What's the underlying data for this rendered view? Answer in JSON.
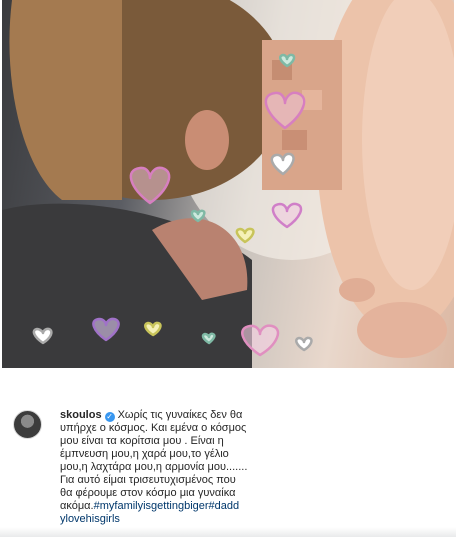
{
  "post": {
    "username": "skoulos",
    "caption_lines": [
      "Χωρίς τις γυναίκες δεν θα",
      "υπήρχε ο κόσμος. Και εμένα ο κόσμος",
      "μου είναι τα κορίτσια μου . Είναι η",
      "έμπνευση μου,η χαρά μου,το γέλιο",
      "μου,η λαχτάρα μου,η αρμονία μου.......",
      "Για αυτό είμαι τρισευτυχισμένος που",
      "θα φέρουμε στον κόσμο μια γυναίκα",
      "ακόμα."
    ],
    "hashtag_1": "#myfamilyisgettingbiger",
    "hashtag_2a": "#dadd",
    "hashtag_2b": "ylovehisgirls"
  },
  "icons": {
    "verified": "verified-badge-icon",
    "hearts": "heart-doodle-icon"
  },
  "colors": {
    "verified": "#3897f0",
    "hashtag": "#00376b",
    "text": "#262626"
  }
}
